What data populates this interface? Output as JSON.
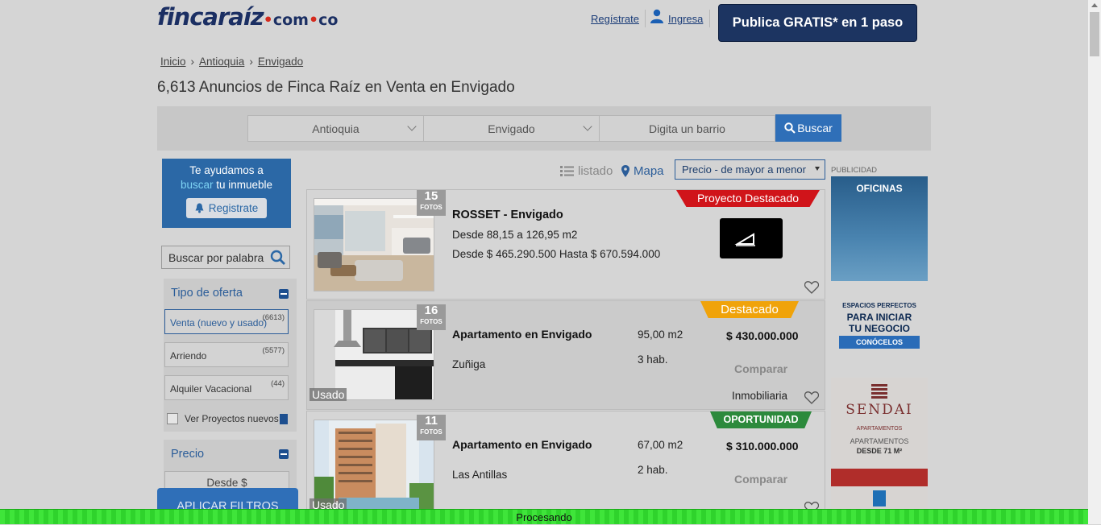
{
  "header": {
    "logo_main": "fincaraíz",
    "logo_dot1": "•",
    "logo_com": "com",
    "logo_dot2": "•",
    "logo_co": "co",
    "register_link": "Regístrate",
    "login_link": "Ingresa",
    "publish_button": "Publica GRATIS* en 1 paso"
  },
  "breadcrumb": {
    "items": [
      "Inicio",
      "Antioquia",
      "Envigado"
    ],
    "separator": "›"
  },
  "page_title": "6,613 Anuncios de Finca Raíz en Venta en Envigado",
  "search": {
    "department": "Antioquia",
    "city": "Envigado",
    "barrio_placeholder": "Digita un barrio",
    "search_button": "Buscar"
  },
  "help_box": {
    "line1": "Te ayudamos a",
    "highlight": "buscar",
    "line2_rest": " tu inmueble",
    "button": "Registrate"
  },
  "keyword_search": {
    "placeholder": "Buscar por palabra"
  },
  "filters": {
    "offer_title": "Tipo de oferta",
    "options": [
      {
        "label": "Venta (nuevo y usado)",
        "count": "(6613)"
      },
      {
        "label": "Arriendo",
        "count": "(5577)"
      },
      {
        "label": "Alquiler Vacacional",
        "count": "(44)"
      }
    ],
    "projects_label": "Ver Proyectos nuevos",
    "price_title": "Precio",
    "price_from": "Desde $",
    "apply_button": "APLICAR FILTROS"
  },
  "list_controls": {
    "list_label": "listado",
    "map_label": "Mapa",
    "sort_selected": "Precio - de mayor a menor"
  },
  "listings": [
    {
      "photos": "15",
      "photos_label": "FOTOS",
      "ribbon": "Proyecto Destacado",
      "title": "ROSSET - Envigado",
      "line1": "Desde 88,15 a 126,95 m2",
      "line2": "Desde $ 465.290.500 Hasta $ 670.594.000"
    },
    {
      "photos": "16",
      "photos_label": "FOTOS",
      "ribbon": "Destacado",
      "condition": "Usado",
      "title": "Apartamento en Envigado",
      "area": "95,00 m2",
      "price": "$ 430.000.000",
      "neighborhood": "Zuñiga",
      "rooms": "3 hab.",
      "compare": "Comparar",
      "seller": "Inmobiliaria"
    },
    {
      "photos": "11",
      "photos_label": "FOTOS",
      "ribbon": "OPORTUNIDAD",
      "condition": "Usado",
      "title": "Apartamento en Envigado",
      "area": "67,00 m2",
      "price": "$ 310.000.000",
      "neighborhood": "Las Antillas",
      "rooms": "2 hab.",
      "compare": "Comparar"
    }
  ],
  "ads": {
    "label": "PUBLICIDAD",
    "ad1_title": "OFICINAS",
    "ad1_text": [
      "ESPACIOS PERFECTOS",
      "PARA INICIAR",
      "TU NEGOCIO"
    ],
    "ad1_button": "CONÓCELOS",
    "ad2_brand": "SENDAI",
    "ad2_sub": "APARTAMENTOS",
    "ad2_text1": "APARTAMENTOS",
    "ad2_text2": "DESDE 71 M²"
  },
  "status": {
    "processing": "Procesando"
  },
  "colors": {
    "brand_navy": "#1c3461",
    "accent_blue": "#2f6fb8",
    "ribbon_red": "#d0141a",
    "ribbon_orange": "#f0a30a",
    "ribbon_green": "#2c8a3c",
    "progress_green": "#3fe53a"
  }
}
